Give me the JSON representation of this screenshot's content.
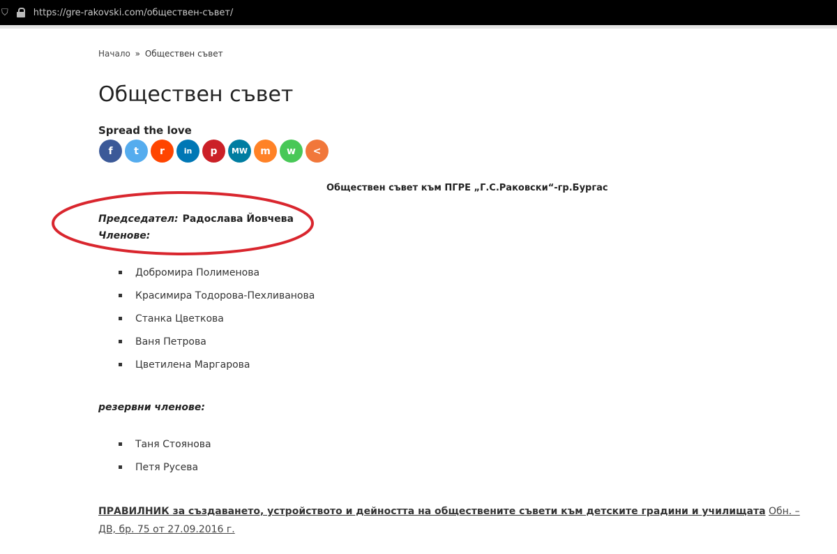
{
  "browser": {
    "url": "https://gre-rakovski.com/обществен-съвет/"
  },
  "breadcrumb": {
    "home": "Начало",
    "separator": "»",
    "current": "Обществен съвет"
  },
  "page_title": "Обществен съвет",
  "share": {
    "heading": "Spread the love",
    "buttons": [
      {
        "name": "facebook",
        "glyph": "f",
        "color": "#3b5998"
      },
      {
        "name": "twitter",
        "glyph": "t",
        "color": "#55acee"
      },
      {
        "name": "reddit",
        "glyph": "r",
        "color": "#ff4500"
      },
      {
        "name": "linkedin",
        "glyph": "in",
        "color": "#0077b5"
      },
      {
        "name": "pinterest",
        "glyph": "p",
        "color": "#cb2027"
      },
      {
        "name": "mewe",
        "glyph": "MW",
        "color": "#007da1"
      },
      {
        "name": "mix",
        "glyph": "m",
        "color": "#ff8226"
      },
      {
        "name": "whatsapp",
        "glyph": "w",
        "color": "#48c857"
      },
      {
        "name": "more",
        "glyph": "<",
        "color": "#f1773a"
      }
    ]
  },
  "council": {
    "heading": "Обществен съвет към ПГРЕ „Г.С.Раковски“-гр.Бургас",
    "chair_label": "Председател:",
    "chair_name": "Радослава Йовчева",
    "members_label": "Членове:",
    "members": [
      "Добромира Полименова",
      "Красимира Тодорова-Пехливанова",
      "Станка Цветкова",
      "Ваня Петрова",
      "Цветилена Маргарова"
    ],
    "reserve_label": "резервни членове:",
    "reserve_members": [
      "Таня Стоянова",
      "Петя Русева"
    ]
  },
  "regulation": {
    "title": "ПРАВИЛНИК за създаването, устройството и дейността на обществените съвети към детските градини и училищата",
    "reference": "Обн. – ДВ, бр. 75 от 27.09.2016 г."
  },
  "colors": {
    "annotation_ellipse": "#d9262e"
  }
}
